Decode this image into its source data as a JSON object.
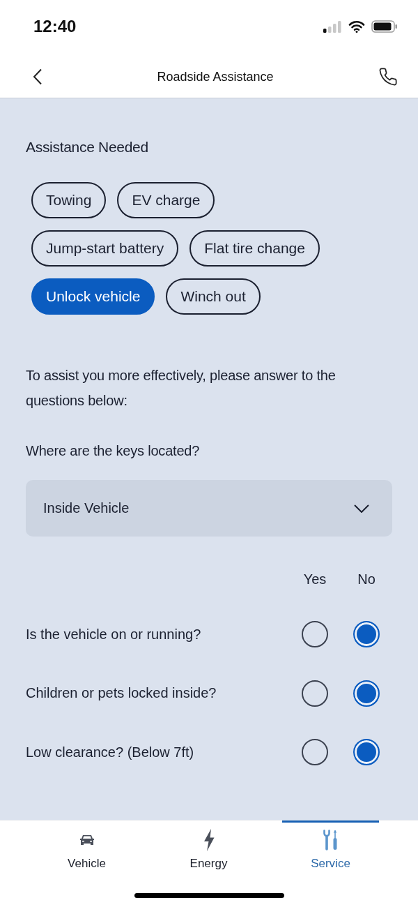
{
  "status_bar": {
    "time": "12:40"
  },
  "header": {
    "title": "Roadside Assistance"
  },
  "assistance": {
    "heading": "Assistance Needed",
    "options": [
      {
        "label": "Towing",
        "selected": false
      },
      {
        "label": "EV charge",
        "selected": false
      },
      {
        "label": "Jump-start battery",
        "selected": false
      },
      {
        "label": "Flat tire change",
        "selected": false
      },
      {
        "label": "Unlock vehicle",
        "selected": true
      },
      {
        "label": "Winch out",
        "selected": false
      }
    ]
  },
  "intro": "To assist you more effectively, please answer to the questions below:",
  "keys": {
    "label": "Where are the keys located?",
    "value": "Inside Vehicle"
  },
  "answers": {
    "columns": [
      "Yes",
      "No"
    ],
    "questions": [
      {
        "text": "Is the vehicle on or running?",
        "choices": [
          {
            "selected": false
          },
          {
            "selected": true
          }
        ]
      },
      {
        "text": "Children or pets locked inside?",
        "choices": [
          {
            "selected": false
          },
          {
            "selected": true
          }
        ]
      },
      {
        "text": "Low clearance? (Below 7ft)",
        "choices": [
          {
            "selected": false
          },
          {
            "selected": true
          }
        ]
      }
    ]
  },
  "tabs": [
    {
      "label": "Vehicle",
      "selected": false
    },
    {
      "label": "Energy",
      "selected": false
    },
    {
      "label": "Service",
      "selected": true
    }
  ]
}
